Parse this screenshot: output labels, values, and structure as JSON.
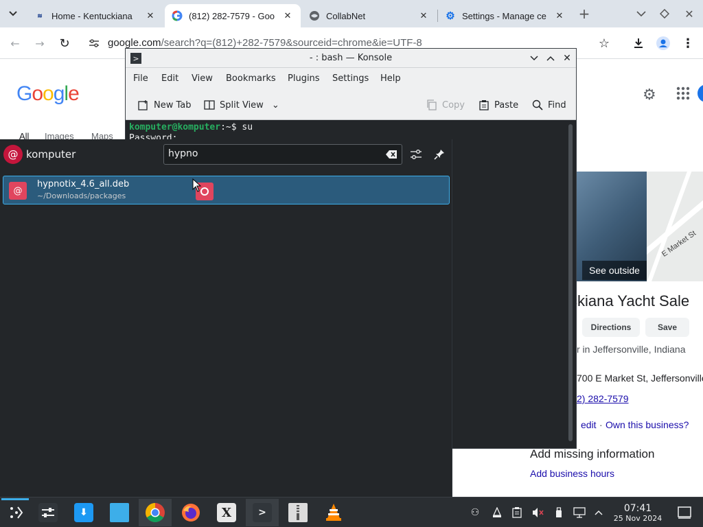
{
  "browser": {
    "tabs": [
      {
        "title": "Home - Kentuckiana",
        "favicon": "site-icon"
      },
      {
        "title": "(812) 282-7579 - Goo",
        "favicon": "google-icon"
      },
      {
        "title": "CollabNet",
        "favicon": "globe-icon"
      },
      {
        "title": "Settings - Manage ce",
        "favicon": "settings-gear-icon"
      }
    ],
    "url_host": "google.com",
    "url_rest": "/search?q=(812)+282-7579&sourceid=chrome&ie=UTF-8"
  },
  "google_page": {
    "logo": "Google",
    "nav": [
      "All",
      "Images",
      "Maps"
    ],
    "see_outside": "See outside",
    "map_label": "E Market St",
    "title": "ckiana Yacht Sale",
    "buttons": {
      "directions": "Directions",
      "save": "Save"
    },
    "category": "r in Jeffersonville, Indiana",
    "address": "700 E Market St, Jeffersonville",
    "phone": "2) 282-7579",
    "suggest": "edit",
    "own_business": "Own this business?",
    "missing_info": "Add missing information",
    "add_hours": "Add business hours"
  },
  "konsole": {
    "title": "- : bash — Konsole",
    "menu": [
      "File",
      "Edit",
      "View",
      "Bookmarks",
      "Plugins",
      "Settings",
      "Help"
    ],
    "toolbar": {
      "new_tab": "New Tab",
      "split_view": "Split View",
      "copy": "Copy",
      "paste": "Paste",
      "find": "Find"
    },
    "terminal": {
      "prompt": "komputer@komputer",
      "path": ":~$",
      "command": " su",
      "line2": "Password:"
    }
  },
  "krunner": {
    "user": "komputer",
    "query": "hypno",
    "result": {
      "name": "hypnotix_4.6_all.deb",
      "path": "~/Downloads/packages"
    }
  },
  "taskbar": {
    "time": "07:41",
    "date": "25 Nov 2024"
  },
  "colors": {
    "accent": "#3daee9",
    "debian_red": "#c4163c",
    "terminal_prompt": "#27ae60"
  }
}
